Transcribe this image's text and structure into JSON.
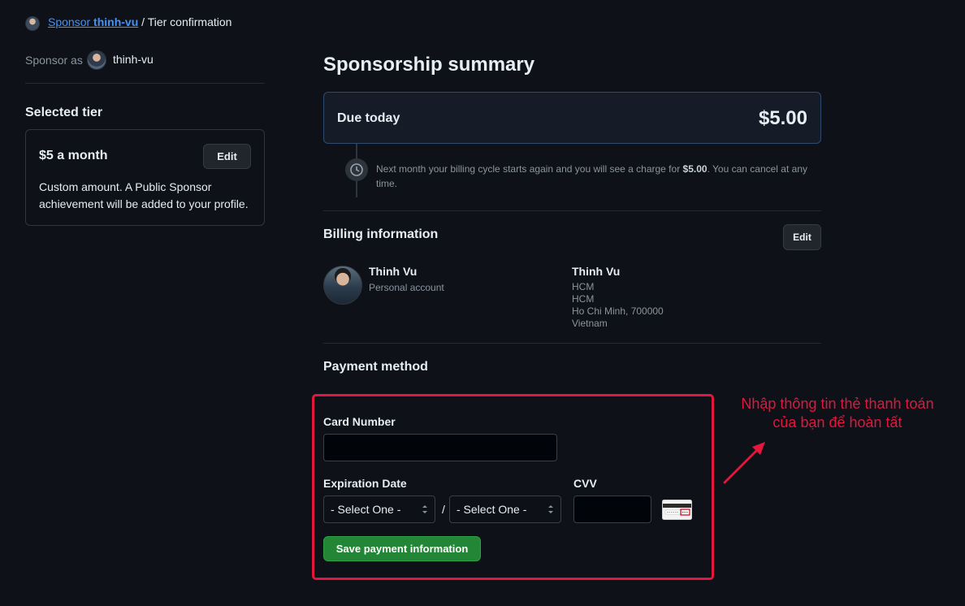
{
  "breadcrumb": {
    "link_prefix": "Sponsor",
    "link_user": "thinh-vu",
    "separator": "/",
    "current": "Tier confirmation"
  },
  "sponsor_as": {
    "label": "Sponsor as",
    "username": "thinh-vu"
  },
  "selected_tier": {
    "heading": "Selected tier",
    "title": "$5 a month",
    "edit_label": "Edit",
    "description": "Custom amount. A Public Sponsor achievement will be added to your profile."
  },
  "summary": {
    "heading": "Sponsorship summary",
    "due_label": "Due today",
    "due_amount": "$5.00",
    "note_prefix": "Next month your billing cycle starts again and you will see a charge for",
    "note_amount": "$5.00",
    "note_suffix": ". You can cancel at any time."
  },
  "billing": {
    "heading": "Billing information",
    "edit_label": "Edit",
    "account_name": "Thinh Vu",
    "account_type": "Personal account",
    "address_name": "Thinh Vu",
    "address_lines": [
      "HCM",
      "HCM",
      "Ho Chi Minh, 700000",
      "Vietnam"
    ]
  },
  "payment": {
    "heading": "Payment method",
    "card_number_label": "Card Number",
    "card_number_value": "",
    "expiration_label": "Expiration Date",
    "month_select": "- Select One -",
    "year_select": "- Select One -",
    "date_separator": "/",
    "cvv_label": "CVV",
    "cvv_value": "",
    "save_label": "Save payment information"
  },
  "annotation": {
    "note": "Nhập thông tin thẻ thanh toán của bạn để hoàn tất",
    "color": "#e3173d"
  },
  "colors": {
    "background": "#0e1118",
    "link": "#4493f8",
    "save_button": "#238636",
    "due_border": "#2f4a70"
  }
}
